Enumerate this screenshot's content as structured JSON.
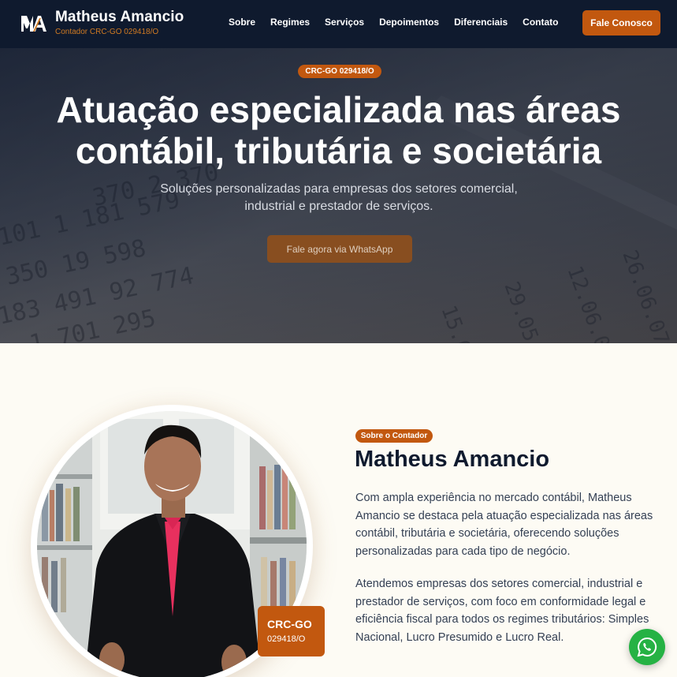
{
  "brand": {
    "logo_icon": "ma-monogram-icon",
    "name": "Matheus Amancio",
    "subtitle": "Contador CRC-GO 029418/O"
  },
  "nav": {
    "links": [
      "Sobre",
      "Regimes",
      "Serviços",
      "Depoimentos",
      "Diferenciais",
      "Contato"
    ],
    "cta": "Fale Conosco"
  },
  "hero": {
    "badge": "CRC-GO 029418/O",
    "title_line1": "Atuação especializada nas áreas",
    "title_line2": "contábil, tributária e societária",
    "subtitle_line1": "Soluções personalizadas para empresas dos setores comercial,",
    "subtitle_line2": "industrial e prestador de serviços.",
    "button": "Fale agora via WhatsApp"
  },
  "about": {
    "badge": "Sobre o Contador",
    "name": "Matheus Amancio",
    "paragraph1": "Com ampla experiência no mercado contábil, Matheus Amancio se destaca pela atuação especializada nas áreas contábil, tributária e societária, oferecendo soluções personalizadas para cada tipo de negócio.",
    "paragraph2": "Atendemos empresas dos setores comercial, industrial e prestador de serviços, com foco em conformidade legal e eficiência fiscal para todos os regimes tributários: Simples Nacional, Lucro Presumido e Lucro Real.",
    "crc_label": "CRC-GO",
    "crc_number": "029418/O"
  },
  "floating": {
    "icon": "whatsapp-icon"
  },
  "colors": {
    "navy": "#0f1a2e",
    "accent": "#c2580f",
    "cream": "#fdfbf4",
    "whatsapp": "#25b244"
  }
}
